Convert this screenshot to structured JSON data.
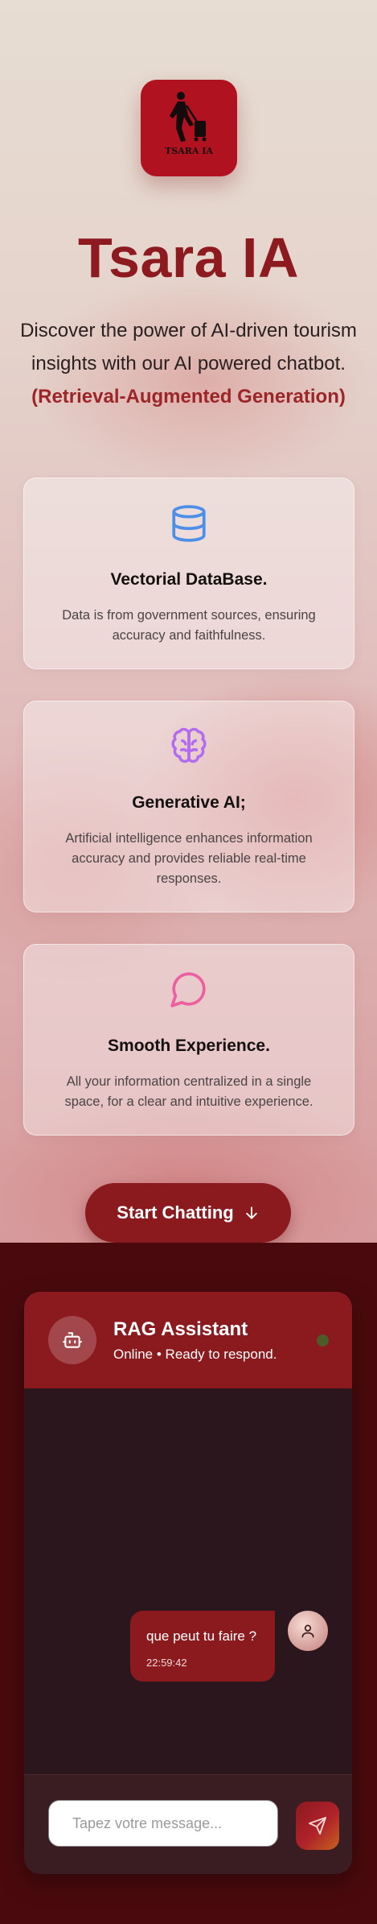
{
  "hero": {
    "logo_text": "TSARA IA",
    "title": "Tsara IA",
    "intro_text": "Discover the power of AI-driven tourism insights with our AI powered chatbot. ",
    "intro_highlight": "(Retrieval-Augmented Generation)"
  },
  "features": [
    {
      "icon": "database-icon",
      "title": "Vectorial DataBase.",
      "description": "Data is from government sources, ensuring accuracy and faithfulness.",
      "icon_color": "#4d8fe8"
    },
    {
      "icon": "brain-icon",
      "title": "Generative AI;",
      "description": "Artificial intelligence enhances information accuracy and provides reliable real-time responses.",
      "icon_color": "#b36bf0"
    },
    {
      "icon": "chat-bubble-icon",
      "title": "Smooth Experience.",
      "description": "All your information centralized in a single space, for a clear and intuitive experience.",
      "icon_color": "#ec5fa1"
    }
  ],
  "cta": {
    "label": "Start Chatting",
    "icon": "arrow-down-icon"
  },
  "chat": {
    "title": "RAG Assistant",
    "status": "Online • Ready to respond.",
    "messages": [
      {
        "from": "user",
        "text": "que peut tu faire ?",
        "time": "22:59:42"
      }
    ],
    "typing": true,
    "input_placeholder": "Tapez votre message...",
    "send_icon": "send-icon"
  },
  "colors": {
    "brand": "#8b1a1f",
    "dark_bg": "#4a0a0d",
    "chat_bg": "#2c161d",
    "typing_dot": "#e2303b",
    "online_dot": "#4d5b28"
  }
}
